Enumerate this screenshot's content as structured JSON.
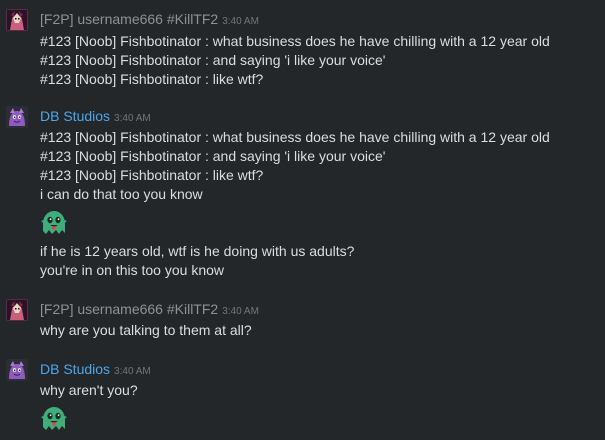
{
  "messages": [
    {
      "author": "[F2P] username666 #KillTF2",
      "time": "3:40 AM",
      "lines": [
        "#123 [Noob] Fishbotinator : what business does he have chilling with a 12 year old",
        "#123 [Noob] Fishbotinator : and saying 'i like your voice'",
        "#123 [Noob] Fishbotinator : like wtf?"
      ]
    },
    {
      "author": "DB Studios",
      "time": "3:40 AM",
      "lines": [
        "#123 [Noob] Fishbotinator : what business does he have chilling with a 12 year old",
        "#123 [Noob] Fishbotinator : and saying 'i like your voice'",
        "#123 [Noob] Fishbotinator : like wtf?",
        "i can do that too you know"
      ],
      "emoji": "green-ghost-tongue-emoji",
      "after_emoji": [
        "if he is 12 years old, wtf is he doing with us adults?",
        "you're in on this too you know"
      ]
    },
    {
      "author": "[F2P] username666 #KillTF2",
      "time": "3:40 AM",
      "lines": [
        "why are you talking to them at all?"
      ]
    },
    {
      "author": "DB Studios",
      "time": "3:40 AM",
      "lines": [
        "why aren't you?"
      ],
      "emoji": "green-ghost-tongue-emoji"
    }
  ],
  "colors": {
    "background": "#23272a",
    "text": "#dcddde",
    "f2p_name": "#8e9297",
    "db_name": "#4fa6ec",
    "timestamp": "#72767d",
    "emoji_green": "#3fae7a"
  }
}
